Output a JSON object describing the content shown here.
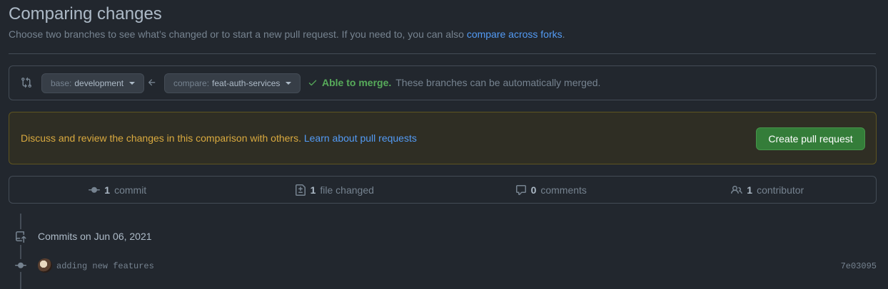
{
  "header": {
    "title": "Comparing changes",
    "subtitle": "Choose two branches to see what’s changed or to start a new pull request. If you need to, you can also ",
    "subtitle_link": "compare across forks",
    "subtitle_end": "."
  },
  "range": {
    "base_label": "base:",
    "base_branch": "development",
    "compare_label": "compare:",
    "compare_branch": "feat-auth-services",
    "merge_ok": "Able to merge.",
    "merge_text": "These branches can be automatically merged."
  },
  "flash": {
    "text": "Discuss and review the changes in this comparison with others. ",
    "link": "Learn about pull requests",
    "button": "Create pull request"
  },
  "stats": [
    {
      "count": "1",
      "label": "commit",
      "icon": "commit-icon"
    },
    {
      "count": "1",
      "label": "file changed",
      "icon": "file-diff-icon"
    },
    {
      "count": "0",
      "label": "comments",
      "icon": "comment-icon"
    },
    {
      "count": "1",
      "label": "contributor",
      "icon": "people-icon"
    }
  ],
  "timeline": {
    "date_heading": "Commits on Jun 06, 2021",
    "commits": [
      {
        "message": "adding new features",
        "sha": "7e03095"
      }
    ]
  },
  "colors": {
    "background": "#22272e",
    "link": "#539bf5",
    "success": "#57ab5a",
    "warning_text": "#daaa3f",
    "button_green": "#347d39"
  }
}
